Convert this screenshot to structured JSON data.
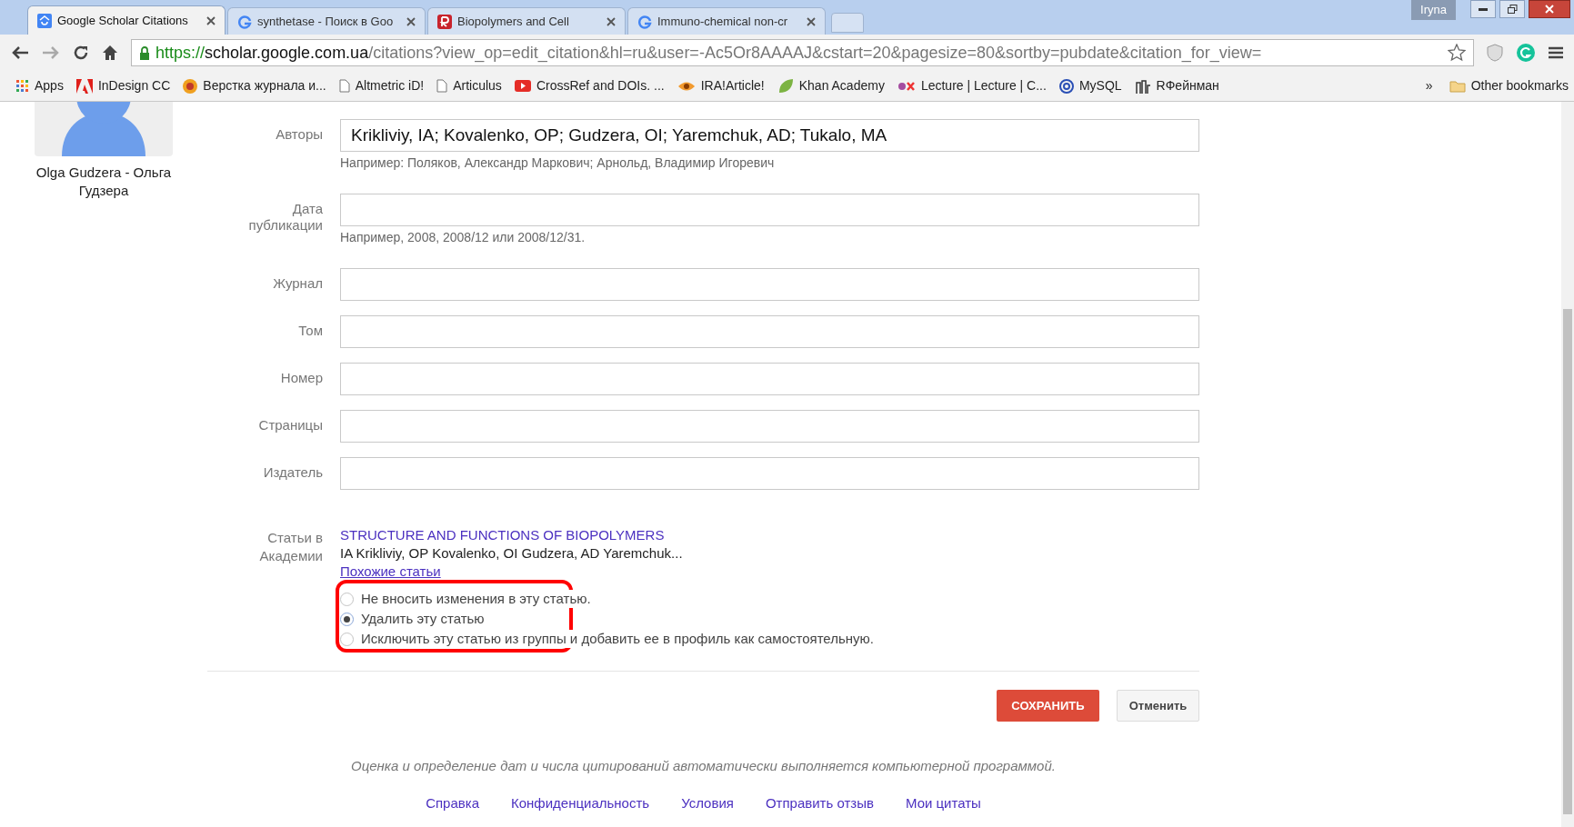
{
  "browser": {
    "tabs": [
      {
        "title": "Google Scholar Citations",
        "selected": true
      },
      {
        "title": "synthetase - Поиск в Goo",
        "selected": false
      },
      {
        "title": "Biopolymers and Cell",
        "selected": false
      },
      {
        "title": "Immuno-chemical non-cr",
        "selected": false
      }
    ],
    "profile": "Iryna",
    "url": {
      "scheme": "https://",
      "host": "scholar.google.com.ua",
      "path": "/citations?view_op=edit_citation&hl=ru&user=-Ac5Or8AAAAJ&cstart=20&pagesize=80&sortby=pubdate&citation_for_view="
    },
    "bookmarks": [
      "Apps",
      "InDesign CC",
      "Верстка журнала и...",
      "Altmetric iD!",
      "Articulus",
      "CrossRef and DOIs. ...",
      "IRA!Article!",
      "Khan Academy",
      "Lecture | Lecture | C...",
      "MySQL",
      "RФейнман"
    ],
    "more": "»",
    "other_bookmarks": "Other bookmarks"
  },
  "profile": {
    "name": "Olga Gudzera - Ольга Гудзера"
  },
  "form": {
    "fields": [
      {
        "label": "Авторы",
        "value": "Krikliviy, IA; Kovalenko, OP; Gudzera, OI; Yaremchuk, AD; Tukalo, MA",
        "hint": "Например: Поляков, Александр Маркович; Арнольд, Владимир Игоревич"
      },
      {
        "label": "Дата публикации",
        "hint": "Например, 2008, 2008/12 или 2008/12/31."
      },
      {
        "label": "Журнал"
      },
      {
        "label": "Том"
      },
      {
        "label": "Номер"
      },
      {
        "label": "Страницы"
      },
      {
        "label": "Издатель"
      }
    ],
    "articles": {
      "label": "Статьи в Академии",
      "title": "STRUCTURE AND FUNCTIONS OF BIOPOLYMERS",
      "authors": "IA Krikliviy, OP Kovalenko, OI Gudzera, AD Yaremchuk...",
      "related": "Похожие статьи",
      "options": [
        {
          "label": "Не вносить изменения в эту статью.",
          "selected": false
        },
        {
          "label": "Удалить эту статью",
          "selected": true
        },
        {
          "label": "Исключить эту статью из группы и добавить ее в профиль как самостоятельную.",
          "selected": false
        }
      ]
    },
    "buttons": {
      "save": "СОХРАНИТЬ",
      "cancel": "Отменить"
    }
  },
  "footer": {
    "note": "Оценка и определение дат и числа цитирований автоматически выполняется компьютерной программой.",
    "links": [
      "Справка",
      "Конфиденциальность",
      "Условия",
      "Отправить отзыв",
      "Мои цитаты"
    ]
  }
}
